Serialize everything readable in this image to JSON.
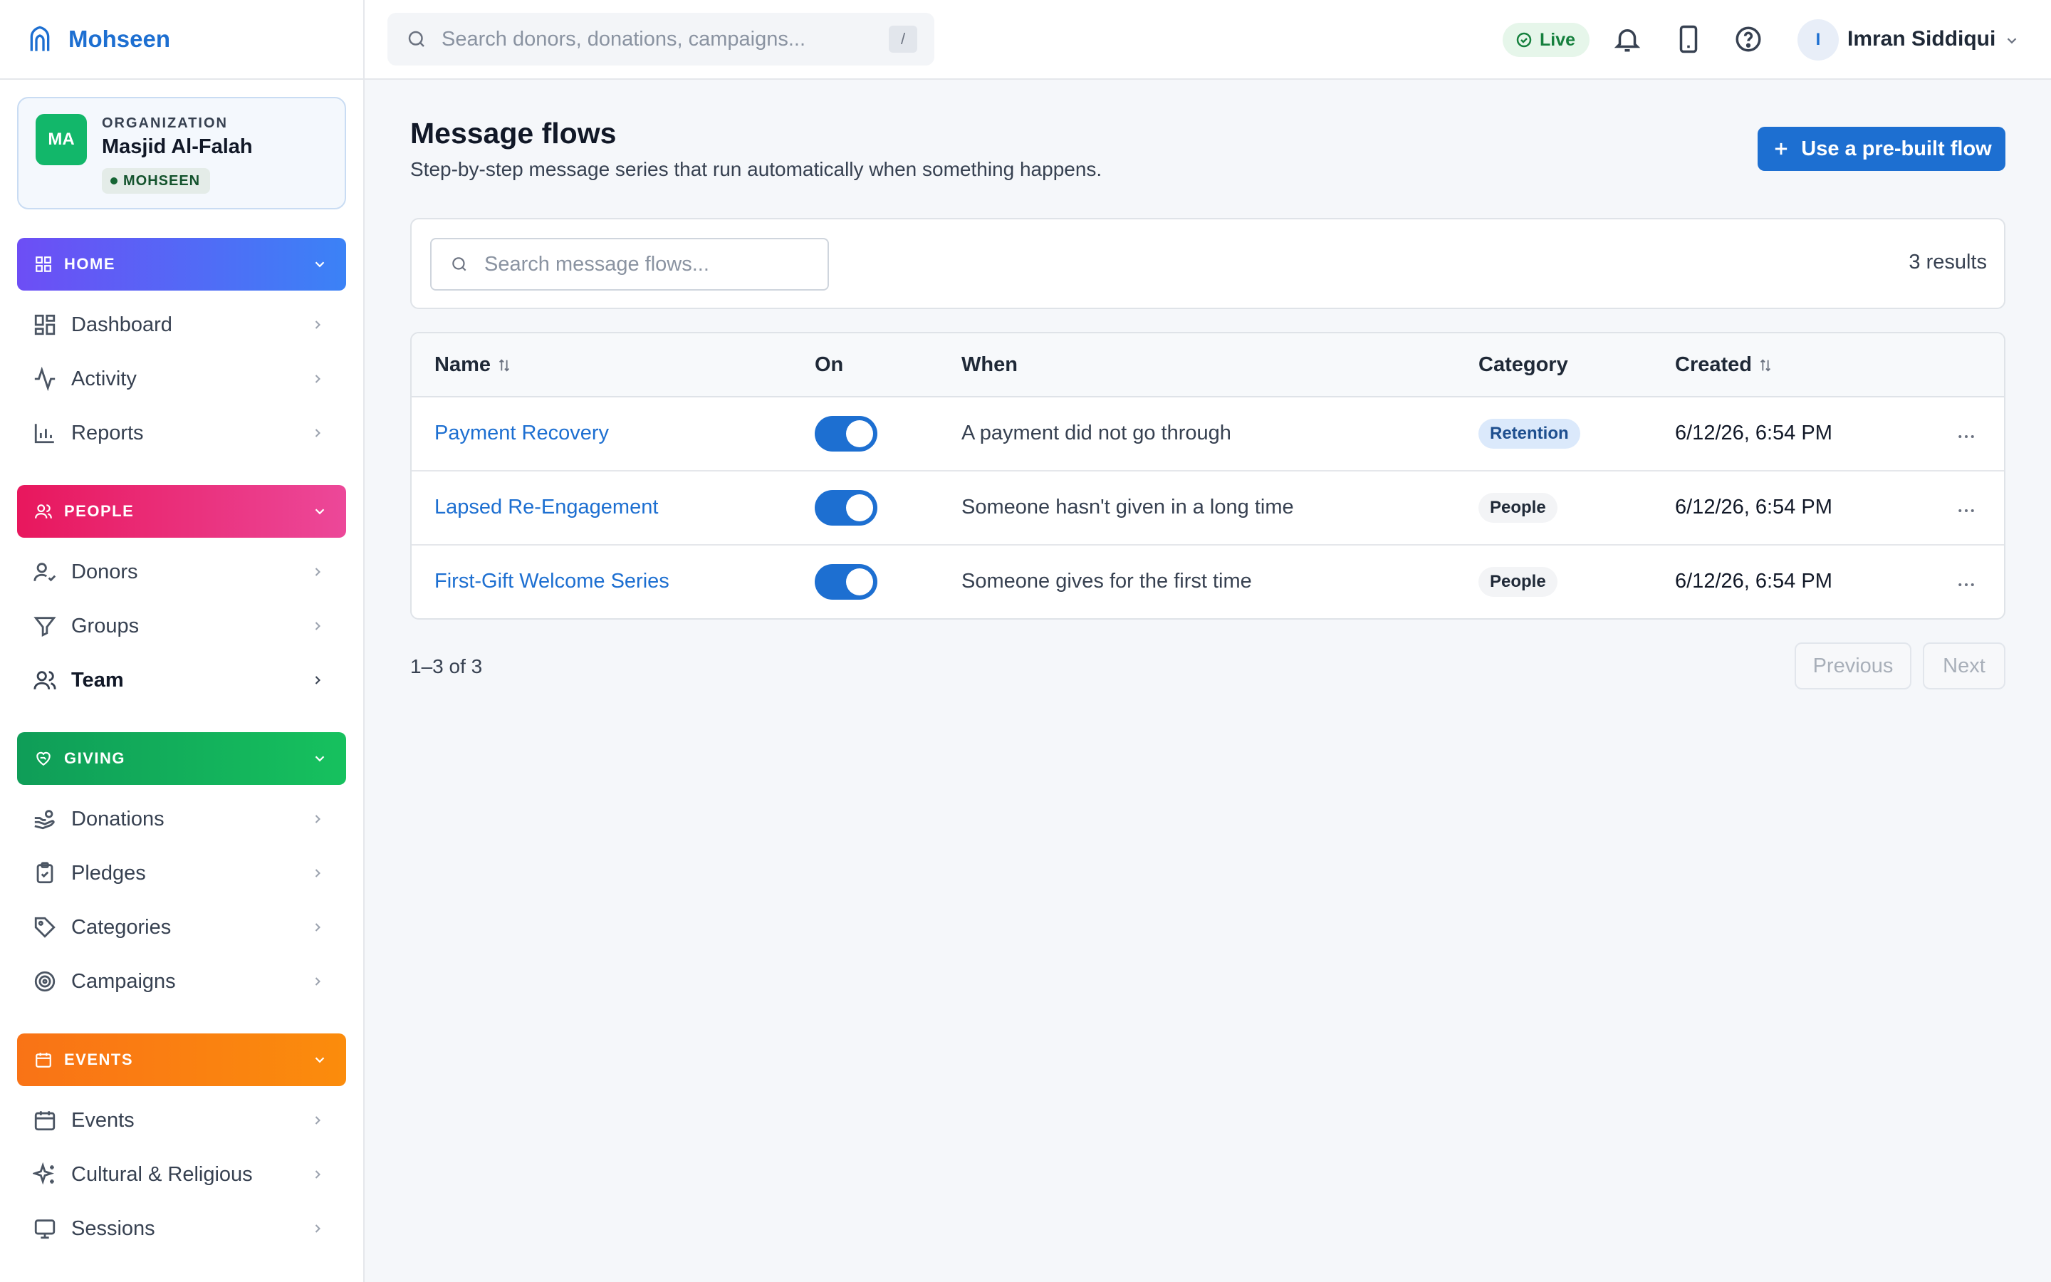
{
  "brand": {
    "name": "Mohseen",
    "logo_icon": "mosque-arch-icon"
  },
  "organization": {
    "kicker": "ORGANIZATION",
    "initials": "MA",
    "name": "Masjid Al-Falah",
    "badge": "MOHSEEN"
  },
  "sidebar": {
    "sections": [
      {
        "label": "HOME",
        "icon": "grid-icon",
        "items": [
          {
            "label": "Dashboard",
            "icon": "dashboard-icon"
          },
          {
            "label": "Activity",
            "icon": "activity-icon"
          },
          {
            "label": "Reports",
            "icon": "bar-chart-icon"
          }
        ]
      },
      {
        "label": "PEOPLE",
        "icon": "users-icon",
        "items": [
          {
            "label": "Donors",
            "icon": "user-check-icon"
          },
          {
            "label": "Groups",
            "icon": "filter-icon"
          },
          {
            "label": "Team",
            "icon": "team-icon",
            "active": true
          }
        ]
      },
      {
        "label": "GIVING",
        "icon": "heart-hand-icon",
        "items": [
          {
            "label": "Donations",
            "icon": "hand-coins-icon"
          },
          {
            "label": "Pledges",
            "icon": "clipboard-check-icon"
          },
          {
            "label": "Categories",
            "icon": "tag-icon"
          },
          {
            "label": "Campaigns",
            "icon": "target-icon"
          }
        ]
      },
      {
        "label": "EVENTS",
        "icon": "calendar-icon",
        "items": [
          {
            "label": "Events",
            "icon": "calendar-icon"
          },
          {
            "label": "Cultural & Religious",
            "icon": "sparkles-icon"
          },
          {
            "label": "Sessions",
            "icon": "monitor-icon"
          }
        ]
      }
    ]
  },
  "topbar": {
    "search_placeholder": "Search donors, donations, campaigns...",
    "search_shortcut": "/",
    "live_label": "Live",
    "user_initial": "I",
    "user_name": "Imran Siddiqui"
  },
  "page": {
    "title": "Message flows",
    "subtitle": "Step-by-step message series that run automatically when something happens.",
    "primary_button": "Use a pre-built flow",
    "search_placeholder": "Search message flows...",
    "results_label": "3 results"
  },
  "table": {
    "columns": {
      "name": "Name",
      "on": "On",
      "when": "When",
      "category": "Category",
      "created": "Created"
    },
    "rows": [
      {
        "name": "Payment Recovery",
        "on": true,
        "when": "A payment did not go through",
        "category": "Retention",
        "created": "6/12/26, 6:54 PM"
      },
      {
        "name": "Lapsed Re-Engagement",
        "on": true,
        "when": "Someone hasn't given in a long time",
        "category": "People",
        "created": "6/12/26, 6:54 PM"
      },
      {
        "name": "First-Gift Welcome Series",
        "on": true,
        "when": "Someone gives for the first time",
        "category": "People",
        "created": "6/12/26, 6:54 PM"
      }
    ]
  },
  "pagination": {
    "info": "1–3 of 3",
    "previous": "Previous",
    "next": "Next"
  },
  "colors": {
    "accent": "#1d6fd1",
    "home": "#6d4ef5",
    "people": "#e8175d",
    "giving": "#0f9d58",
    "events": "#f97316"
  }
}
